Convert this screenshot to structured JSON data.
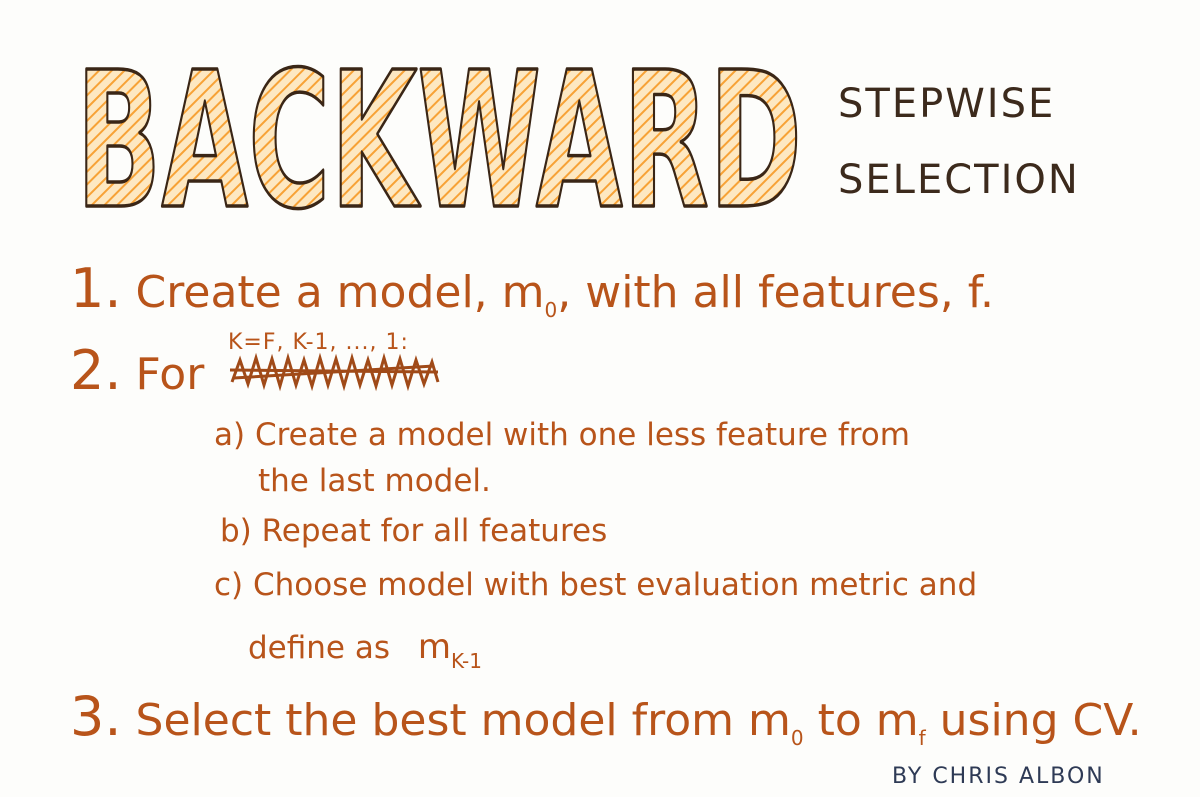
{
  "title": {
    "main": "BACKWARD",
    "line1": "STEPWISE",
    "line2": "SELECTION"
  },
  "colors": {
    "ink": "#b8541a",
    "title_fill": "#f7a236",
    "title_stroke": "#3a2616",
    "byline": "#2e3a55"
  },
  "steps": {
    "s1": {
      "num": "1.",
      "text": "Create a model, m",
      "sub": "0",
      "text_after": ", with all features, f."
    },
    "s2": {
      "num": "2.",
      "text": "For",
      "range": "K=F, K-1, ..., 1:"
    },
    "s2a": {
      "label": "a)",
      "line1": "Create a model with one less feature from",
      "line2": "the last model."
    },
    "s2b": {
      "label": "b)",
      "text": "Repeat for all features"
    },
    "s2c": {
      "label": "c)",
      "line1": "Choose model with best evaluation metric and",
      "line2": "define as",
      "math": "m",
      "math_sub": "K-1"
    },
    "s3": {
      "num": "3.",
      "text": "Select the best model from m",
      "sub": "0",
      "mid": " to m",
      "sub2": "f",
      "after": " using CV."
    }
  },
  "byline": "BY CHRIS ALBON"
}
